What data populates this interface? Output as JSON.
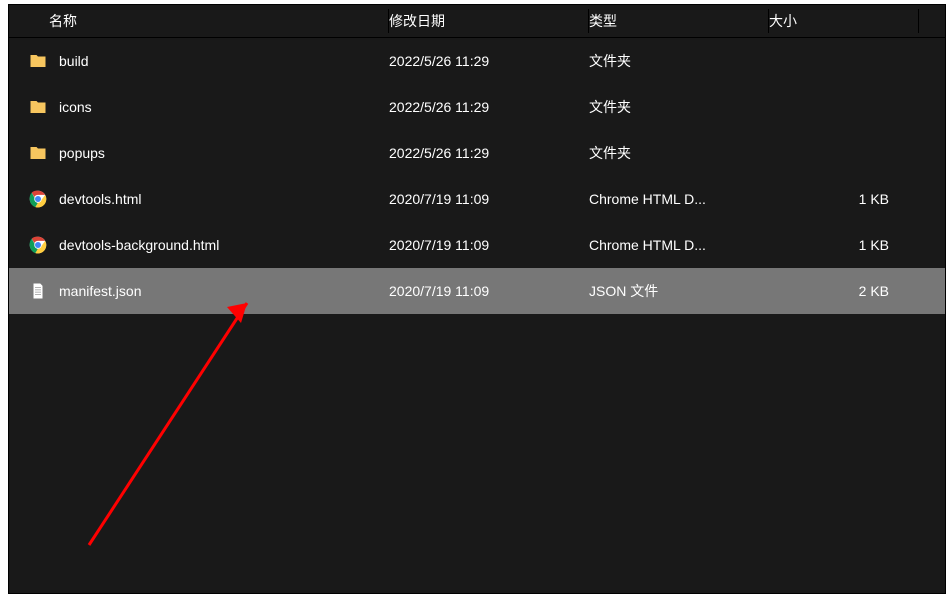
{
  "columns": {
    "name": "名称",
    "date": "修改日期",
    "type": "类型",
    "size": "大小"
  },
  "rows": [
    {
      "icon": "folder",
      "name": "build",
      "date": "2022/5/26 11:29",
      "type": "文件夹",
      "size": "",
      "selected": false
    },
    {
      "icon": "folder",
      "name": "icons",
      "date": "2022/5/26 11:29",
      "type": "文件夹",
      "size": "",
      "selected": false
    },
    {
      "icon": "folder",
      "name": "popups",
      "date": "2022/5/26 11:29",
      "type": "文件夹",
      "size": "",
      "selected": false
    },
    {
      "icon": "chrome",
      "name": "devtools.html",
      "date": "2020/7/19 11:09",
      "type": "Chrome HTML D...",
      "size": "1 KB",
      "selected": false
    },
    {
      "icon": "chrome",
      "name": "devtools-background.html",
      "date": "2020/7/19 11:09",
      "type": "Chrome HTML D...",
      "size": "1 KB",
      "selected": false
    },
    {
      "icon": "document",
      "name": "manifest.json",
      "date": "2020/7/19 11:09",
      "type": "JSON 文件",
      "size": "2 KB",
      "selected": true
    }
  ],
  "annotation_color": "#ff0000"
}
